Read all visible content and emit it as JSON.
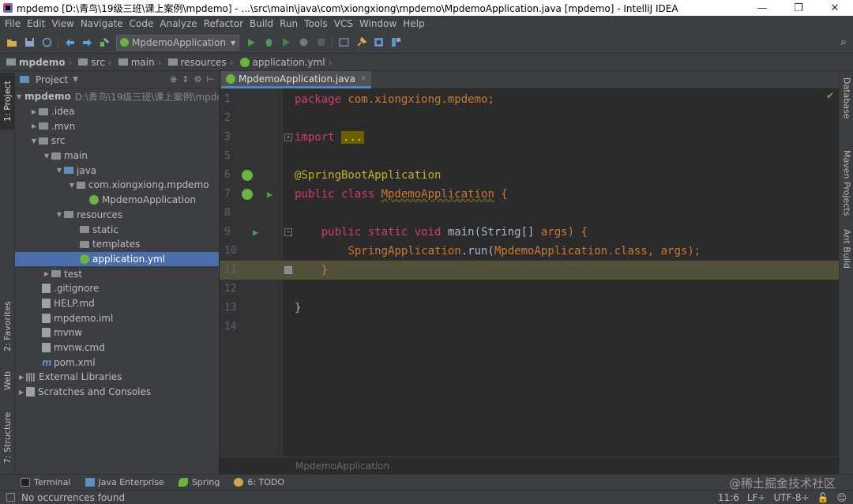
{
  "window": {
    "title": "mpdemo [D:\\青鸟\\19级三班\\课上案例\\mpdemo] - ...\\src\\main\\java\\com\\xiongxiong\\mpdemo\\MpdemoApplication.java [mpdemo] - IntelliJ IDEA",
    "minimize": "—",
    "restore": "❐",
    "close": "✕"
  },
  "menu": [
    "File",
    "Edit",
    "View",
    "Navigate",
    "Code",
    "Analyze",
    "Refactor",
    "Build",
    "Run",
    "Tools",
    "VCS",
    "Window",
    "Help"
  ],
  "toolbar": {
    "run_config": "MpdemoApplication",
    "dropdown": "▾",
    "search_icon": "⌕"
  },
  "navbar": [
    "mpdemo",
    "src",
    "main",
    "resources",
    "application.yml"
  ],
  "left_tabs": {
    "project": "1: Project",
    "favorites": "2: Favorites",
    "web": "Web",
    "structure": "7: Structure"
  },
  "right_tabs": {
    "database": "Database",
    "maven": "Maven Projects",
    "ant": "Ant Build"
  },
  "project_panel": {
    "title": "Project",
    "tree": [
      {
        "label": "mpdemo",
        "extra": "D:\\青鸟\\19级三班\\课上案例\\mpdemo"
      },
      {
        "label": ".idea"
      },
      {
        "label": ".mvn"
      },
      {
        "label": "src"
      },
      {
        "label": "main"
      },
      {
        "label": "java"
      },
      {
        "label": "com.xiongxiong.mpdemo"
      },
      {
        "label": "MpdemoApplication"
      },
      {
        "label": "resources"
      },
      {
        "label": "static"
      },
      {
        "label": "templates"
      },
      {
        "label": "application.yml"
      },
      {
        "label": "test"
      },
      {
        "label": ".gitignore"
      },
      {
        "label": "HELP.md"
      },
      {
        "label": "mpdemo.iml"
      },
      {
        "label": "mvnw"
      },
      {
        "label": "mvnw.cmd"
      },
      {
        "label": "pom.xml"
      },
      {
        "label": "External Libraries"
      },
      {
        "label": "Scratches and Consoles"
      }
    ]
  },
  "editor": {
    "tab": "MpdemoApplication.java",
    "tab_close": "×",
    "lines": {
      "l1": {
        "num": "1",
        "kw": "package ",
        "rest": "com.xiongxiong.mpdemo;"
      },
      "l2": {
        "num": "2"
      },
      "l3": {
        "num": "3",
        "kw": "import ",
        "fold": "..."
      },
      "l5": {
        "num": "5"
      },
      "l6": {
        "num": "6",
        "ann": "@SpringBootApplication"
      },
      "l7": {
        "num": "7",
        "kw": "public class ",
        "cls": "MpdemoApplication",
        "rest": " {"
      },
      "l8": {
        "num": "8"
      },
      "l9": {
        "num": "9",
        "kw": "public static void ",
        "name": "main",
        "p1": "(String[] ",
        "arg": "args",
        "p2": ") {"
      },
      "l10": {
        "num": "10",
        "a": "SpringApplication",
        "b": ".run(",
        "c": "MpdemoApplication",
        "d": ".class, ",
        "e": "args",
        "f": ");"
      },
      "l11": {
        "num": "11",
        "brace": "}"
      },
      "l12": {
        "num": "12"
      },
      "l13": {
        "num": "13",
        "brace": "}"
      },
      "l14": {
        "num": "14"
      }
    },
    "breadcrumb": "MpdemoApplication"
  },
  "bottom_tabs": {
    "terminal": "Terminal",
    "java_ee": "Java Enterprise",
    "spring": "Spring",
    "todo": "6: TODO"
  },
  "watermark": "@稀土掘金技术社区",
  "status": {
    "message": "No occurrences found",
    "position": "11:6",
    "line_sep": "LF÷",
    "encoding": "UTF-8÷"
  }
}
